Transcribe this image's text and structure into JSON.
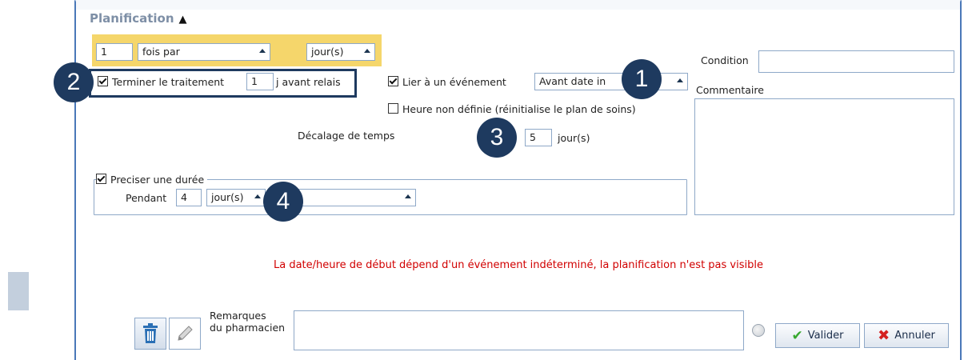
{
  "section": {
    "title": "Planification"
  },
  "frequency": {
    "count": "1",
    "mode": "fois par",
    "unit": "jour(s)"
  },
  "terminate": {
    "checked": true,
    "label": "Terminer le traitement",
    "days": "1",
    "suffix": "j avant relais"
  },
  "link_event": {
    "checked": true,
    "label": "Lier à un événement",
    "select_value": "Avant date in"
  },
  "undefined_time": {
    "checked": false,
    "label": "Heure non définie (réinitialise le plan de soins)"
  },
  "time_offset": {
    "label": "Décalage de temps",
    "value": "5",
    "unit": "jour(s)"
  },
  "duration": {
    "checked": true,
    "legend": "Preciser une durée",
    "during_label": "Pendant",
    "value": "4",
    "unit": "jour(s)",
    "extra_select": ""
  },
  "condition": {
    "label": "Condition",
    "value": ""
  },
  "comment": {
    "label": "Commentaire",
    "value": ""
  },
  "warning": "La date/heure de début dépend d'un événement indéterminé, la planification n'est pas visible",
  "remarks": {
    "label_line1": "Remarques",
    "label_line2": "du pharmacien",
    "value": ""
  },
  "buttons": {
    "validate": "Valider",
    "cancel": "Annuler"
  },
  "callouts": [
    "1",
    "2",
    "3",
    "4"
  ],
  "icons": [
    "trash-icon",
    "pencil-icon",
    "radio-icon",
    "check-icon",
    "cross-icon"
  ],
  "colors": {
    "accent": "#1e3a5f",
    "highlight": "#f5d66b",
    "warning": "#d10000",
    "border": "#8ea8c8"
  }
}
